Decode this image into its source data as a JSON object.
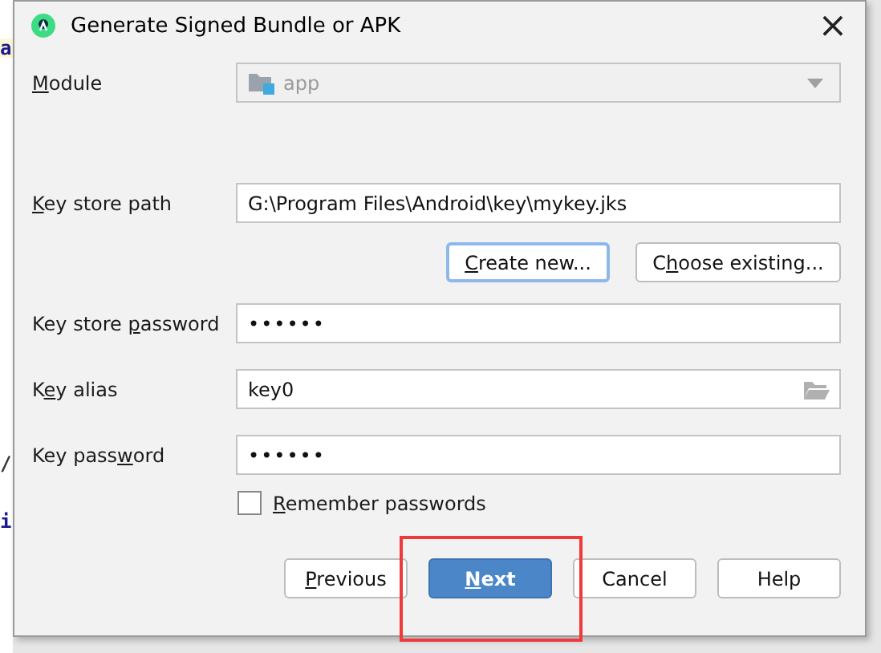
{
  "background": {
    "code_fragments": [
      "a",
      "/",
      "i"
    ]
  },
  "window": {
    "title": "Generate Signed Bundle or APK",
    "close": "×"
  },
  "module": {
    "label": {
      "key": "M",
      "post": "odule"
    },
    "value": "app",
    "disabled": true
  },
  "key_store_path": {
    "label": {
      "key": "K",
      "post": "ey store path"
    },
    "value": "G:\\Program Files\\Android\\key\\mykey.jks"
  },
  "key_store_buttons": [
    {
      "key": "C",
      "post": "reate new...",
      "focused": true
    },
    {
      "pre": "C",
      "key": "h",
      "post": "oose existing...",
      "focused": false
    }
  ],
  "fields": [
    {
      "kind": "password",
      "label": {
        "pre": "Key store ",
        "key": "p",
        "post": "assword"
      },
      "value": "••••••"
    },
    {
      "kind": "browse",
      "label": {
        "pre": "K",
        "key": "e",
        "post": "y alias"
      },
      "value": "key0"
    },
    {
      "kind": "password",
      "label": {
        "pre": "Key pass",
        "key": "w",
        "post": "ord"
      },
      "value": "••••••"
    }
  ],
  "remember": {
    "label": {
      "key": "R",
      "post": "emember passwords"
    },
    "checked": false
  },
  "buttons": [
    {
      "key": "P",
      "post": "revious",
      "primary": false
    },
    {
      "key": "N",
      "post": "ext",
      "primary": true
    },
    {
      "pre": "Cancel",
      "primary": false
    },
    {
      "pre": "Help",
      "primary": false
    }
  ],
  "annotation": {
    "kind": "rectangle"
  }
}
